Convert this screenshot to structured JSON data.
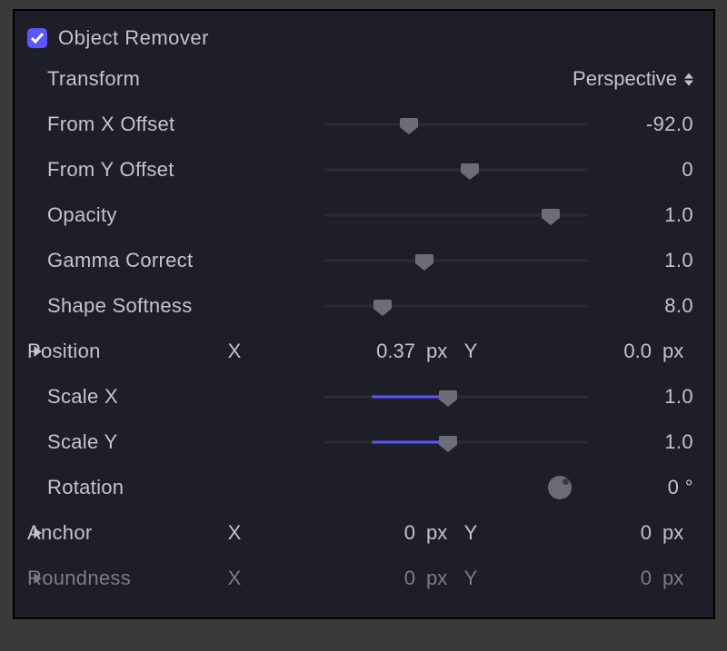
{
  "header": {
    "title": "Object Remover",
    "checked": true
  },
  "transform": {
    "label": "Transform",
    "value": "Perspective"
  },
  "sliders": {
    "fromX": {
      "label": "From X Offset",
      "value": "-92.0",
      "pos": 32,
      "fill": false
    },
    "fromY": {
      "label": "From Y Offset",
      "value": "0",
      "pos": 55,
      "fill": false
    },
    "opacity": {
      "label": "Opacity",
      "value": "1.0",
      "pos": 86,
      "fill": false
    },
    "gamma": {
      "label": "Gamma Correct",
      "value": "1.0",
      "pos": 38,
      "fill": false
    },
    "softness": {
      "label": "Shape Softness",
      "value": "8.0",
      "pos": 22,
      "fill": false
    },
    "scaleX": {
      "label": "Scale X",
      "value": "1.0",
      "pos": 47,
      "fill": true,
      "fillFrom": 18
    },
    "scaleY": {
      "label": "Scale Y",
      "value": "1.0",
      "pos": 47,
      "fill": true,
      "fillFrom": 18
    }
  },
  "position": {
    "label": "Position",
    "x": "0.37",
    "y": "0.0",
    "unit": "px"
  },
  "rotation": {
    "label": "Rotation",
    "value": "0",
    "unit": "°"
  },
  "anchor": {
    "label": "Anchor",
    "x": "0",
    "y": "0",
    "unit": "px"
  },
  "roundness": {
    "label": "Roundness",
    "x": "0",
    "y": "0",
    "unit": "px"
  }
}
